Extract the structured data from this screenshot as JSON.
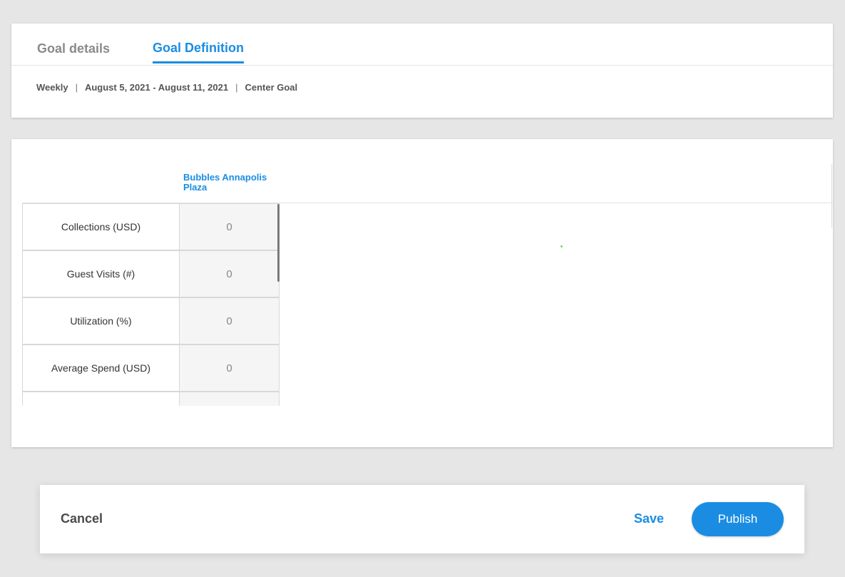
{
  "tabs": [
    {
      "label": "Goal details",
      "active": false
    },
    {
      "label": "Goal Definition",
      "active": true
    }
  ],
  "summary": {
    "period": "Weekly",
    "date_range": "August 5, 2021 - August 11, 2021",
    "goal_type": "Center Goal",
    "separator": "|"
  },
  "table": {
    "column_header": "Bubbles Annapolis Plaza",
    "rows": [
      {
        "label": "Collections (USD)",
        "value": "0"
      },
      {
        "label": "Guest Visits (#)",
        "value": "0"
      },
      {
        "label": "Utilization (%)",
        "value": "0"
      },
      {
        "label": "Average Spend (USD)",
        "value": "0"
      },
      {
        "label": "",
        "value": ""
      }
    ]
  },
  "footer": {
    "cancel_label": "Cancel",
    "save_label": "Save",
    "publish_label": "Publish"
  },
  "colors": {
    "accent": "#1a8de3",
    "background": "#e6e6e6"
  }
}
